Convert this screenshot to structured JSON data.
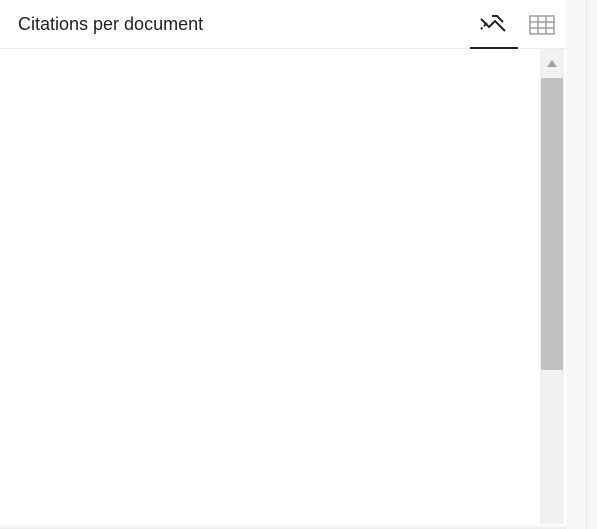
{
  "panel": {
    "title": "Citations per document",
    "views": [
      {
        "name": "chart",
        "icon": "line-chart-icon",
        "selected": true
      },
      {
        "name": "table",
        "icon": "table-grid-icon",
        "selected": false
      }
    ]
  },
  "colors": {
    "panel_background": "#ffffff",
    "page_background": "#f7f7f7",
    "text": "#222222",
    "active_indicator": "#222222",
    "inactive_icon": "#9e9e9e",
    "scrollbar_track": "#f1f1f1",
    "scrollbar_thumb": "#c1c1c1"
  }
}
